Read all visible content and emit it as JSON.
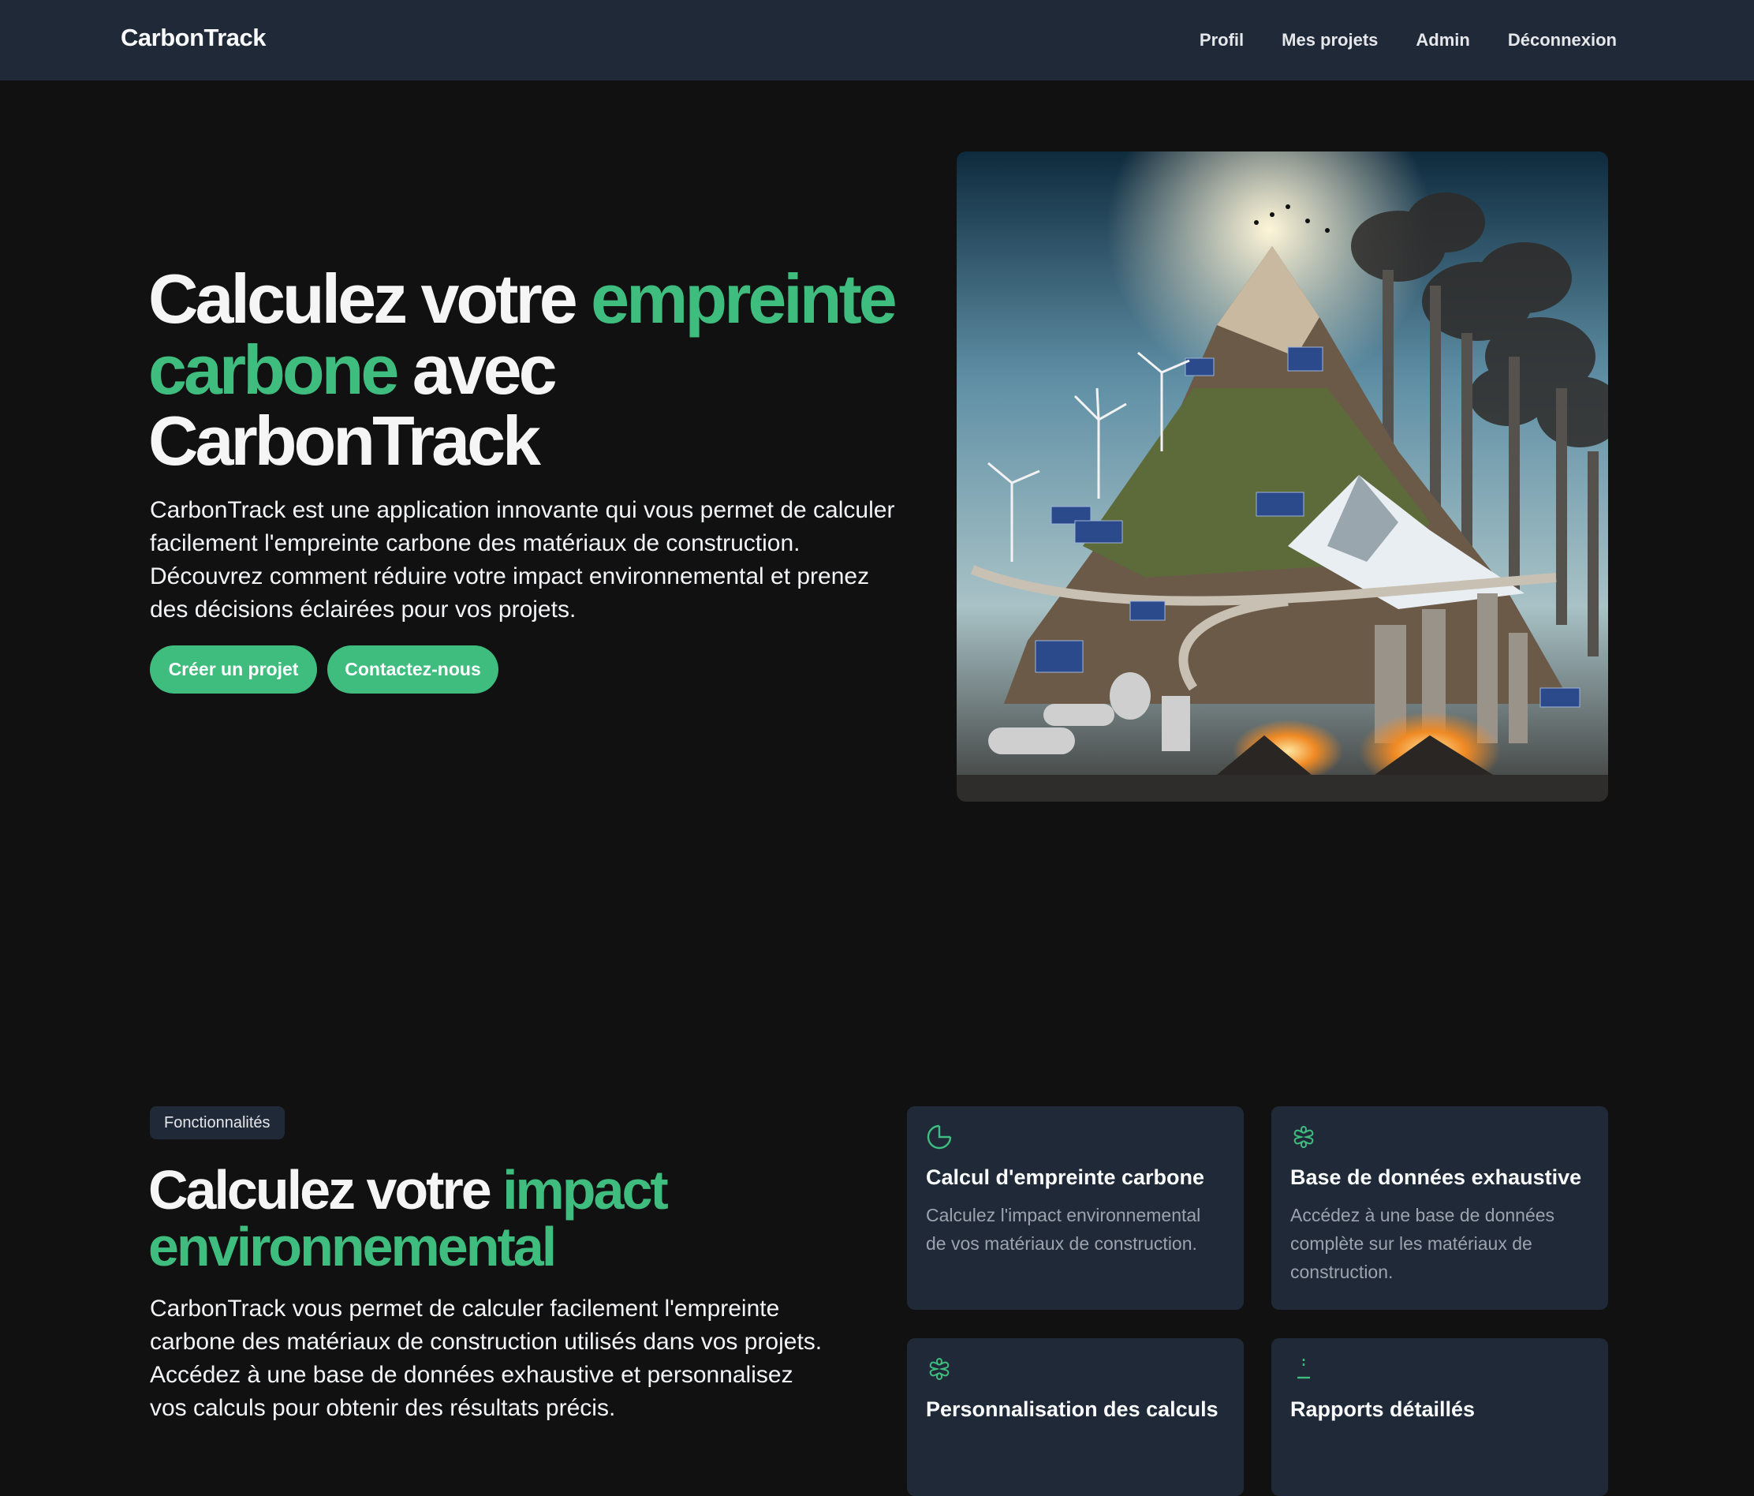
{
  "nav": {
    "brand": "CarbonTrack",
    "links": [
      "Profil",
      "Mes projets",
      "Admin",
      "Déconnexion"
    ]
  },
  "hero": {
    "title_part1": "Calculez votre ",
    "title_highlight": "empreinte carbone",
    "title_part2": " avec CarbonTrack",
    "description": "CarbonTrack est une application innovante qui vous permet de calculer facilement l'empreinte carbone des matériaux de construction. Découvrez comment réduire votre impact environnemental et prenez des décisions éclairées pour vos projets.",
    "create_button": "Créer un projet",
    "contact_button": "Contactez-nous"
  },
  "features": {
    "badge": "Fonctionnalités",
    "title_part1": "Calculez votre ",
    "title_highlight": "impact environnemental",
    "description": "CarbonTrack vous permet de calculer facilement l'empreinte carbone des matériaux de construction utilisés dans vos projets. Accédez à une base de données exhaustive et personnalisez vos calculs pour obtenir des résultats précis.",
    "cards": [
      {
        "icon": "pie-chart-icon",
        "title": "Calcul d'empreinte carbone",
        "text": "Calculez l'impact environnemental de vos matériaux de construction."
      },
      {
        "icon": "flower-icon",
        "title": "Base de données exhaustive",
        "text": "Accédez à une base de données complète sur les matériaux de construction."
      },
      {
        "icon": "flower-icon",
        "title": "Personnalisation des calculs",
        "text": ""
      },
      {
        "icon": "report-icon",
        "title": "Rapports détaillés",
        "text": ""
      }
    ]
  },
  "colors": {
    "accent": "#3ebd7f",
    "background": "#111112",
    "surface": "#1f2937"
  }
}
